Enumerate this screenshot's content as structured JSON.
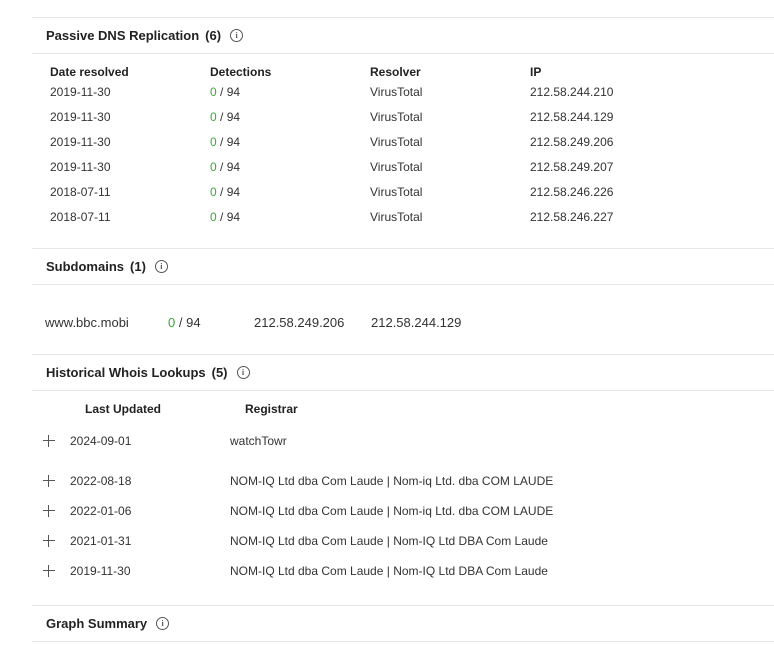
{
  "pdns": {
    "title": "Passive DNS Replication",
    "count": "(6)",
    "headers": [
      "Date resolved",
      "Detections",
      "Resolver",
      "IP"
    ],
    "rows": [
      {
        "date": "2019-11-30",
        "det": "0",
        "total": "/ 94",
        "resolver": "VirusTotal",
        "ip": "212.58.244.210"
      },
      {
        "date": "2019-11-30",
        "det": "0",
        "total": "/ 94",
        "resolver": "VirusTotal",
        "ip": "212.58.244.129"
      },
      {
        "date": "2019-11-30",
        "det": "0",
        "total": "/ 94",
        "resolver": "VirusTotal",
        "ip": "212.58.249.206"
      },
      {
        "date": "2019-11-30",
        "det": "0",
        "total": "/ 94",
        "resolver": "VirusTotal",
        "ip": "212.58.249.207"
      },
      {
        "date": "2018-07-11",
        "det": "0",
        "total": "/ 94",
        "resolver": "VirusTotal",
        "ip": "212.58.246.226"
      },
      {
        "date": "2018-07-11",
        "det": "0",
        "total": "/ 94",
        "resolver": "VirusTotal",
        "ip": "212.58.246.227"
      }
    ]
  },
  "subdomains": {
    "title": "Subdomains",
    "count": "(1)",
    "rows": [
      {
        "domain": "www.bbc.mobi",
        "det": "0",
        "total": "/ 94",
        "ip1": "212.58.249.206",
        "ip2": "212.58.244.129"
      }
    ]
  },
  "whois": {
    "title": "Historical Whois Lookups",
    "count": "(5)",
    "headers": [
      "Last Updated",
      "Registrar"
    ],
    "rows": [
      {
        "date": "2024-09-01",
        "registrar": "watchTowr"
      },
      {
        "date": "2022-08-18",
        "registrar": "NOM-IQ Ltd dba Com Laude | Nom-iq Ltd. dba COM LAUDE"
      },
      {
        "date": "2022-01-06",
        "registrar": "NOM-IQ Ltd dba Com Laude | Nom-iq Ltd. dba COM LAUDE"
      },
      {
        "date": "2021-01-31",
        "registrar": "NOM-IQ Ltd dba Com Laude | Nom-IQ Ltd DBA Com Laude"
      },
      {
        "date": "2019-11-30",
        "registrar": "NOM-IQ Ltd dba Com Laude | Nom-IQ Ltd DBA Com Laude"
      }
    ]
  },
  "graph": {
    "title": "Graph Summary"
  },
  "info_glyph": "i",
  "colors": {
    "detections_ok": "#3aa73a",
    "divider": "#e6e6e6"
  }
}
